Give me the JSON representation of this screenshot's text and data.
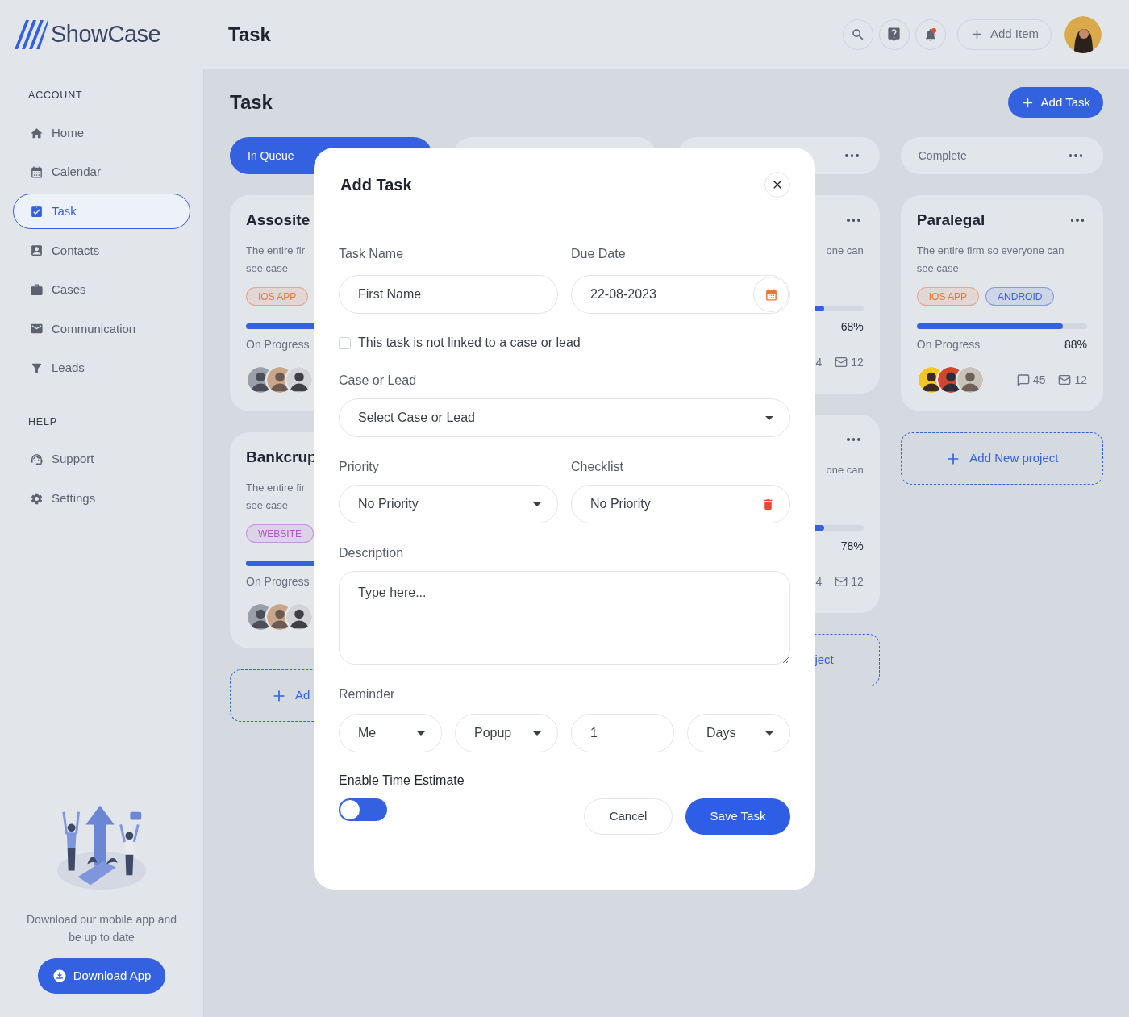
{
  "header": {
    "logo": "ShowCase",
    "title": "Task",
    "add_item": "Add Item",
    "notifications": {
      "unread": true
    }
  },
  "sidebar": {
    "sections": [
      {
        "title": "ACCOUNT",
        "items": [
          {
            "label": "Home",
            "selected": false
          },
          {
            "label": "Calendar",
            "selected": false
          },
          {
            "label": "Task",
            "selected": true
          },
          {
            "label": "Contacts",
            "selected": false
          },
          {
            "label": "Cases",
            "selected": false
          },
          {
            "label": "Communication",
            "selected": false
          },
          {
            "label": "Leads",
            "selected": false
          }
        ]
      },
      {
        "title": "HELP",
        "items": [
          {
            "label": "Support",
            "selected": false
          },
          {
            "label": "Settings",
            "selected": false
          }
        ]
      }
    ],
    "promo": {
      "text": "Download our mobile app and be up to date",
      "button": "Download App"
    }
  },
  "main": {
    "title": "Task",
    "add_button": "Add Task",
    "columns": [
      {
        "header": {
          "label": "In Queue",
          "selected": true,
          "menu": false
        },
        "cards": [
          {
            "title": "Assosite",
            "description": [
              "The entire fir",
              "see case"
            ],
            "tags": [
              {
                "label": "IOS APP",
                "color": "#e8773a"
              }
            ],
            "progress": {
              "label": "On Progress",
              "level": 0.8
            },
            "avatars": [
              {
                "kind": "picture"
              },
              {
                "kind": "picture"
              },
              {
                "kind": "picture"
              }
            ]
          },
          {
            "title": "Bankcrup",
            "description": [
              "The entire fir",
              "see case"
            ],
            "tags": [
              {
                "label": "WEBSITE",
                "color": "#b44fd6"
              }
            ],
            "progress": {
              "label": "On Progress",
              "level": 0.8
            },
            "avatars": [
              {
                "kind": "picture"
              },
              {
                "kind": "picture"
              },
              {
                "kind": "picture"
              }
            ]
          }
        ],
        "add": {
          "label": "Ad",
          "icon": true
        }
      },
      {
        "header": {
          "selected": false
        }
      },
      {
        "header": {
          "selected": false,
          "menu": true
        },
        "cards": [
          {
            "description": [
              "one can"
            ],
            "progress": {
              "value": "68%",
              "level": 0.77
            },
            "counts": [
              {
                "kind": "count",
                "value": "4"
              },
              {
                "kind": "mail",
                "value": "12"
              }
            ],
            "menu": true
          },
          {
            "description": [
              "one can"
            ],
            "progress": {
              "value": "78%",
              "level": 0.77
            },
            "counts": [
              {
                "kind": "count",
                "value": "4"
              },
              {
                "kind": "mail",
                "value": "12"
              }
            ],
            "menu": true
          }
        ],
        "add": {
          "label": "ject"
        }
      },
      {
        "header": {
          "label": "Complete",
          "selected": false,
          "menu": true
        },
        "cards": [
          {
            "title": "Paralegal",
            "description": [
              "The entire firm so everyone can",
              "see case"
            ],
            "tags": [
              {
                "label": "IOS APP",
                "color": "#e8773a"
              },
              {
                "label": "ANDROID",
                "color": "#3d5fd9"
              }
            ],
            "progress": {
              "label": "On Progress",
              "value": "88%",
              "level": 0.86
            },
            "avatars": [
              {
                "kind": "picture"
              },
              {
                "kind": "picture"
              },
              {
                "kind": "picture"
              }
            ],
            "counts": [
              {
                "kind": "comments",
                "value": "45"
              },
              {
                "kind": "mail",
                "value": "12"
              }
            ],
            "menu": true
          }
        ],
        "add": {
          "label": "Add New project",
          "icon": true
        }
      }
    ]
  },
  "modal": {
    "title": "Add Task",
    "task_name": {
      "label": "Task Name",
      "placeholder": "First Name"
    },
    "due_date": {
      "label": "Due Date",
      "value": "22-08-2023"
    },
    "unlinked": {
      "label": "This task is not linked to a case or lead",
      "checked": false
    },
    "case_or_lead": {
      "label": "Case or Lead",
      "value": "Select Case or Lead"
    },
    "priority": {
      "label": "Priority",
      "value": "No Priority"
    },
    "checklist": {
      "label": "Checklist",
      "value": "No Priority"
    },
    "description": {
      "label": "Description",
      "placeholder": "Type here..."
    },
    "reminder": {
      "label": "Reminder",
      "fields": [
        {
          "kind": "select",
          "value": "Me"
        },
        {
          "kind": "select",
          "value": "Popup"
        },
        {
          "kind": "input",
          "value": "1"
        },
        {
          "kind": "select",
          "value": "Days"
        }
      ]
    },
    "time_estimate": {
      "label": "Enable Time Estimate",
      "on": false
    },
    "buttons": {
      "cancel": "Cancel",
      "save": "Save Task"
    }
  }
}
